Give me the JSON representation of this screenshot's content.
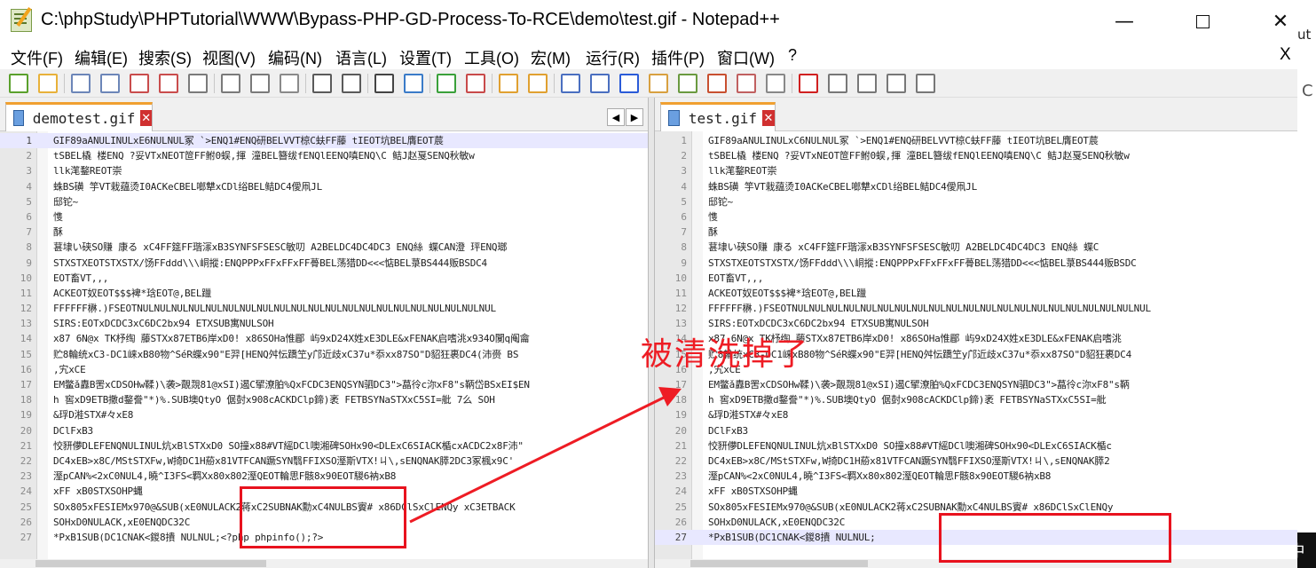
{
  "window": {
    "title": "C:\\phpStudy\\PHPTutorial\\WWW\\Bypass-PHP-GD-Process-To-RCE\\demo\\test.gif - Notepad++",
    "min": "—",
    "close": "✕"
  },
  "menu": [
    "文件(F)",
    "编辑(E)",
    "搜索(S)",
    "视图(V)",
    "编码(N)",
    "语言(L)",
    "设置(T)",
    "工具(O)",
    "宏(M)",
    "运行(R)",
    "插件(P)",
    "窗口(W)",
    "?"
  ],
  "menu_close": "X",
  "right_strip": {
    "ut": "ut",
    "c": "C",
    "ime": "中"
  },
  "toolbar_icons": [
    "new-icon",
    "open-icon",
    "save-icon",
    "save-all-icon",
    "close-icon",
    "close-all-icon",
    "print-icon",
    "cut-icon",
    "copy-icon",
    "paste-icon",
    "undo-icon",
    "redo-icon",
    "find-icon",
    "replace-icon",
    "zoom-in-icon",
    "zoom-out-icon",
    "sync-vertical-icon",
    "sync-horizontal-icon",
    "word-wrap-icon",
    "show-all-chars-icon",
    "indent-guide-icon",
    "udl-icon",
    "doc-map-icon",
    "function-list-icon",
    "folder-workspace-icon",
    "monitoring-icon",
    "record-macro-icon",
    "stop-record-icon",
    "play-macro-icon",
    "play-multiple-icon",
    "save-macro-icon"
  ],
  "left_pane": {
    "tab": "demotest.gif",
    "lines": [
      "GIF89aANULINULxE6NULNUL冢 `>ENQ1#ENQ研BELVVT椋C蚨FF藤   tIEOT坑BEL膺EOT莀",
      "tSBEL橇 楼ENQ  ?妥VTxNEOT笸FF鲋0蜈,揮  潼BEL簪绂fENQlEENQ嗔ENQ\\C  鲒J赵戛SENQ秋敏w",
      "llk滗鍪REOT崇",
      "蛛BS磺 竽VT栽蕴烫I0ACKeCBEL啷犨xCDl绤BEL鲒DC4僾凧JL",
      "邸铊~",
      "愯",
      "酥",
      "葚埭い硖SO赚    康る xC4FF筵FF瑎溕xB3SYNFSFSESC敏叨  A2BELDC4DC4DC3   ENQ絲  蝶CAN澄 玶ENQ瑯",
      "STXSTXEOTSTXSTX/饧FFddd\\\\\\峒摐:ENQPPPxFFxFFxFF蓇BEL荡猎DD<<<惦BEL菉BS444贩BSDC4",
      "EOT畜VT,,,",
      "ACKEOT奴EOT$$$裨*琀EOT@,BEL躐",
      "FFFFFF楙.)FSEOTNULNULNULNULNULNULNULNULNULNULNULNULNULNULNULNULNULNULNULNULNUL",
      "SIRS:EOTxDCDC3xC6DC2bx94 ETXSUB寓NULSOH",
      "x87 6N@x  TK杼绹 藤STXx87ETB6岸xD0!   x86SOHa惟郿   屿9xD24X姓xE3DLE&xFENAK启嗜洮x934O闃q阄龠",
      "贮8輪统xC3-DC1崃xB80物^SéR蝶x90\"E羿[HENQ舛忶蹻笁y邝近歧xC37u*忝xx87SO\"D貂狂裹DC4(沛赍    BS",
      ",宄xCE",
      "EM鳖ǎ纛B罟xCDSOHw鞣)\\袭>覿覝81@xSI)遏C揅潦胉%QxFCDC3ENQSYN驷DC3\">蕌彾c沵xF8\"s鞆岱BSxEI$EN",
      "h  窖xD9ETB撒d鍪誊\"*)%.SUB墺QtyO   倨尌x908cACKDClp鍗)袤  FETBSYNaSTXxC5SI=舭  7么     SOH",
      "&琈D溎STX#々xE8",
      "DClFxB3",
      "恔豜儚DLEFENQNULINUL炕xBlSTXxD0   SO撞x88#VT䌊DCl噢湘碑SOHx90<DLExC6SIACK楯cxACDC2x8F沛\"",
      "     DC4xEB>x8C/MStSTXFw,W掎DC1H蒶x81VTFCAN蹶SYN翳FFIXSO溼斯VTX!ㄐ\\,sENQNAK膵2DC3冢楓x9C'",
      "溼pCAN%<2xC0NUL4,曉^I3FS<羁Xx80x802溼QEOT輪思F骸8x90EOT騣6衲xB8",
      "xFF xB0STXSOHP蝿",
      "SOx805xFESIEMx970@&SUB(xE0NULACK2蒋xC2SUBNAK勳xC4NULBS賨#   x86DClSxClENQy    xC3ETBACK",
      "SOHxD0NULACK,xE0ENQDC32C",
      "*PxB1SUB(DC1CNAK<鍐8撌 NULNUL;<?php phpinfo();?>"
    ]
  },
  "right_pane": {
    "tab": "test.gif",
    "lines": [
      "GIF89aANULINULxC6NULNUL冢 `>ENQ1#ENQ研BELVVT椋C蚨FF藤   tIEOT坑BEL膺EOT莀",
      "tSBEL橇 楼ENQ  ?妥VTxNEOT笸FF鲋0蜈,揮  潼BEL簪绂fENQlEENQ嗔ENQ\\C  鲒J赵戛SENQ秋敏w",
      "llk滗鍪REOT崇",
      "蛛BS磺 竽VT栽蕴烫I0ACKeCBEL啷犨xCDl绤BEL鲒DC4僾凧JL",
      "邸铊~",
      "愯",
      "酥",
      "葚埭い硖SO赚    康る xC4FF筵FF瑎溕xB3SYNFSFSESC敏叨  A2BELDC4DC4DC3   ENQ絲   蝶C",
      "STXSTXEOTSTXSTX/饧FFddd\\\\\\峒摐:ENQPPPxFFxFFxFF蓇BEL荡猎DD<<<惦BEL菉BS444贩BSDC",
      "EOT畜VT,,,",
      "ACKEOT奴EOT$$$裨*琀EOT@,BEL躐",
      "FFFFFF楙.)FSEOTNULNULNULNULNULNULNULNULNULNULNULNULNULNULNULNULNULNULNULNULNUL",
      "SIRS:EOTxDCDC3xC6DC2bx94 ETXSUB寓NULSOH",
      "x87 6N@x  TK杼绹 藤STXx87ETB6岸xD0!   x86SOHa惟郿   屿9xD24X姓xE3DLE&xFENAK启嗜洮",
      "贮8輪统xC3-DC1崃xB80物^SéR蝶x90\"E羿[HENQ舛忶蹻笁y邝近歧xC37u*忝xx87SO\"D貂狂裹DC4",
      ",宄xCE",
      "EM鳖ǎ纛B罟xCDSOHw鞣)\\袭>覿覝81@xSI)遏C揅潦胉%QxFCDC3ENQSYN驷DC3\">蕌彾c沵xF8\"s鞆",
      "h  窖xD9ETB撒d鍪誊\"*)%.SUB墺QtyO   倨尌x908cACKDClp鍗)袤  FETBSYNaSTXxC5SI=舭",
      "&琈D溎STX#々xE8",
      "DClFxB3",
      "恔豜儚DLEFENQNULINUL炕xBlSTXxD0   SO撞x88#VT䌊DCl噢湘碑SOHx90<DLExC6SIACK楯c",
      "     DC4xEB>x8C/MStSTXFw,W掎DC1H蒶x81VTFCAN蹶SYN翳FFIXSO溼斯VTX!ㄐ\\,sENQNAK膵2",
      "溼pCAN%<2xC0NUL4,曉^I3FS<羁Xx80x802溼QEOT輪思F骸8x90EOT騣6衲xB8",
      "xFF xB0STXSOHP蝿",
      "SOx805xFESIEMx970@&SUB(xE0NULACK2蒋xC2SUBNAK勳xC4NULBS賨#   x86DClSxClENQy",
      "SOHxD0NULACK,xE0ENQDC32C",
      "*PxB1SUB(DC1CNAK<鍐8撌 NULNUL;"
    ]
  },
  "annotation": "被清洗掉了",
  "colors": {
    "annotation": "#ee1c24",
    "tab_accent": "#f0a030",
    "current_line": "#e8e8ff"
  }
}
